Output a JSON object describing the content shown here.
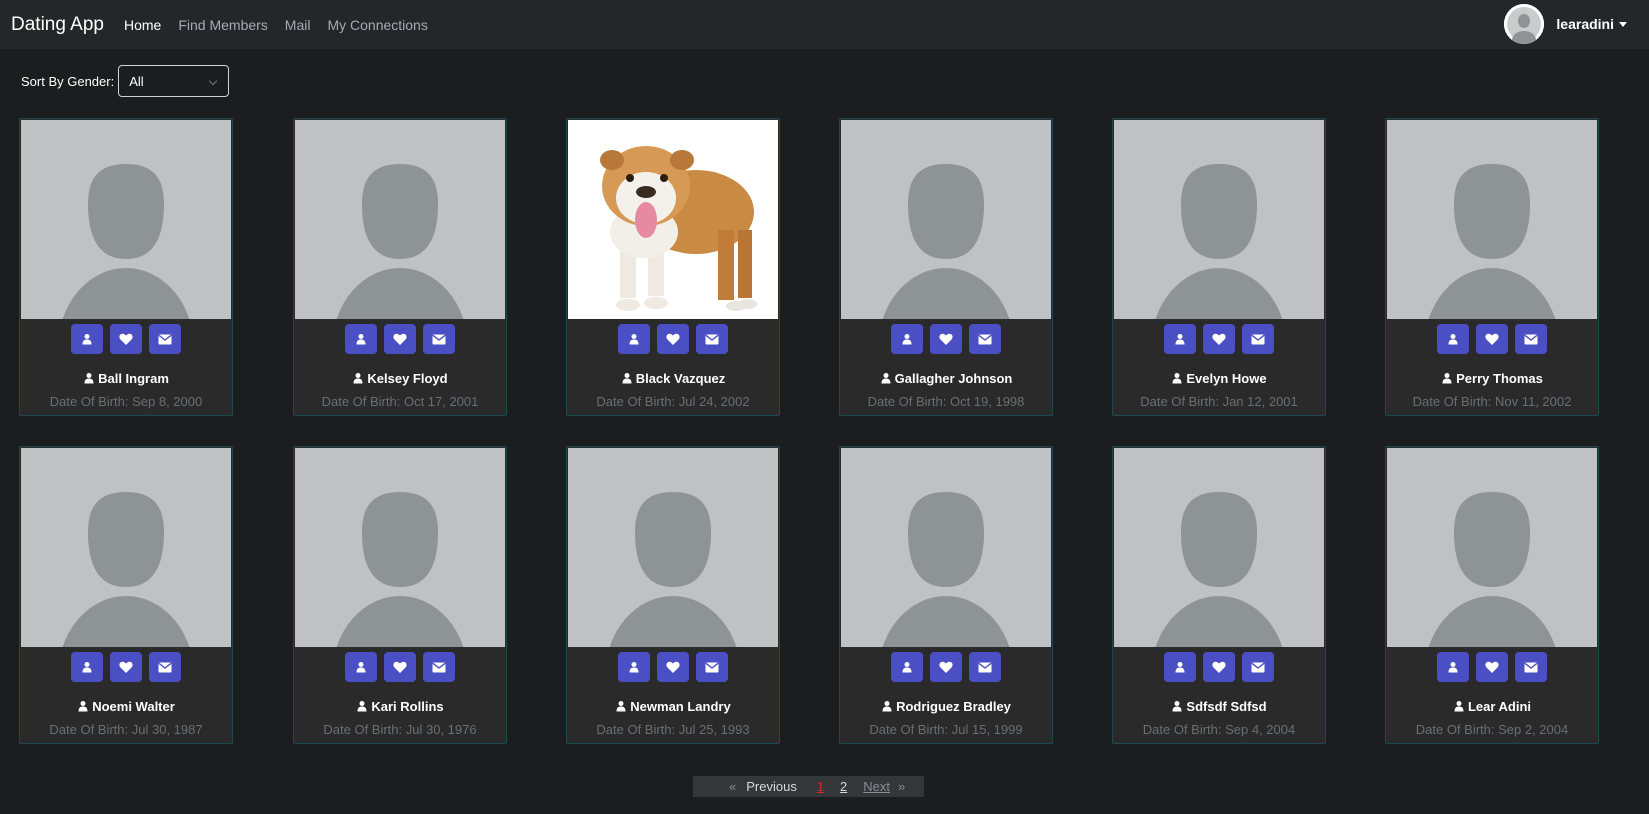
{
  "navbar": {
    "brand": "Dating App",
    "links": [
      "Home",
      "Find Members",
      "Mail",
      "My Connections"
    ],
    "username": "learadini"
  },
  "filter": {
    "label": "Sort By Gender:",
    "selected": "All"
  },
  "members": [
    {
      "name": "Ball Ingram",
      "dob": "Date Of Birth: Sep 8, 2000",
      "photo": "placeholder-silhouette"
    },
    {
      "name": "Kelsey Floyd",
      "dob": "Date Of Birth: Oct 17, 2001",
      "photo": "placeholder-silhouette"
    },
    {
      "name": "Black Vazquez",
      "dob": "Date Of Birth: Jul 24, 2002",
      "photo": "bulldog-photo"
    },
    {
      "name": "Gallagher Johnson",
      "dob": "Date Of Birth: Oct 19, 1998",
      "photo": "placeholder-silhouette"
    },
    {
      "name": "Evelyn Howe",
      "dob": "Date Of Birth: Jan 12, 2001",
      "photo": "placeholder-silhouette"
    },
    {
      "name": "Perry Thomas",
      "dob": "Date Of Birth: Nov 11, 2002",
      "photo": "placeholder-silhouette"
    },
    {
      "name": "Noemi Walter",
      "dob": "Date Of Birth: Jul 30, 1987",
      "photo": "placeholder-silhouette"
    },
    {
      "name": "Kari Rollins",
      "dob": "Date Of Birth: Jul 30, 1976",
      "photo": "placeholder-silhouette"
    },
    {
      "name": "Newman Landry",
      "dob": "Date Of Birth: Jul 25, 1993",
      "photo": "placeholder-silhouette"
    },
    {
      "name": "Rodriguez Bradley",
      "dob": "Date Of Birth: Jul 15, 1999",
      "photo": "placeholder-silhouette"
    },
    {
      "name": "Sdfsdf Sdfsd",
      "dob": "Date Of Birth: Sep 4, 2004",
      "photo": "placeholder-silhouette"
    },
    {
      "name": "Lear Adini",
      "dob": "Date Of Birth: Sep 2, 2004",
      "photo": "placeholder-silhouette"
    }
  ],
  "card_actions": [
    "user-icon",
    "heart-icon",
    "envelope-icon"
  ],
  "pagination": {
    "prev_arrow": "«",
    "previous": "Previous",
    "pages": [
      "1",
      "2"
    ],
    "current": "1",
    "next": "Next",
    "next_arrow": "»"
  },
  "colors": {
    "background": "#1c1d1f",
    "navbar": "#242629",
    "card": "#2a2a2a",
    "card_border": "#1d4a52",
    "action_button": "#4a4fc4",
    "active_page": "#d9262c"
  }
}
